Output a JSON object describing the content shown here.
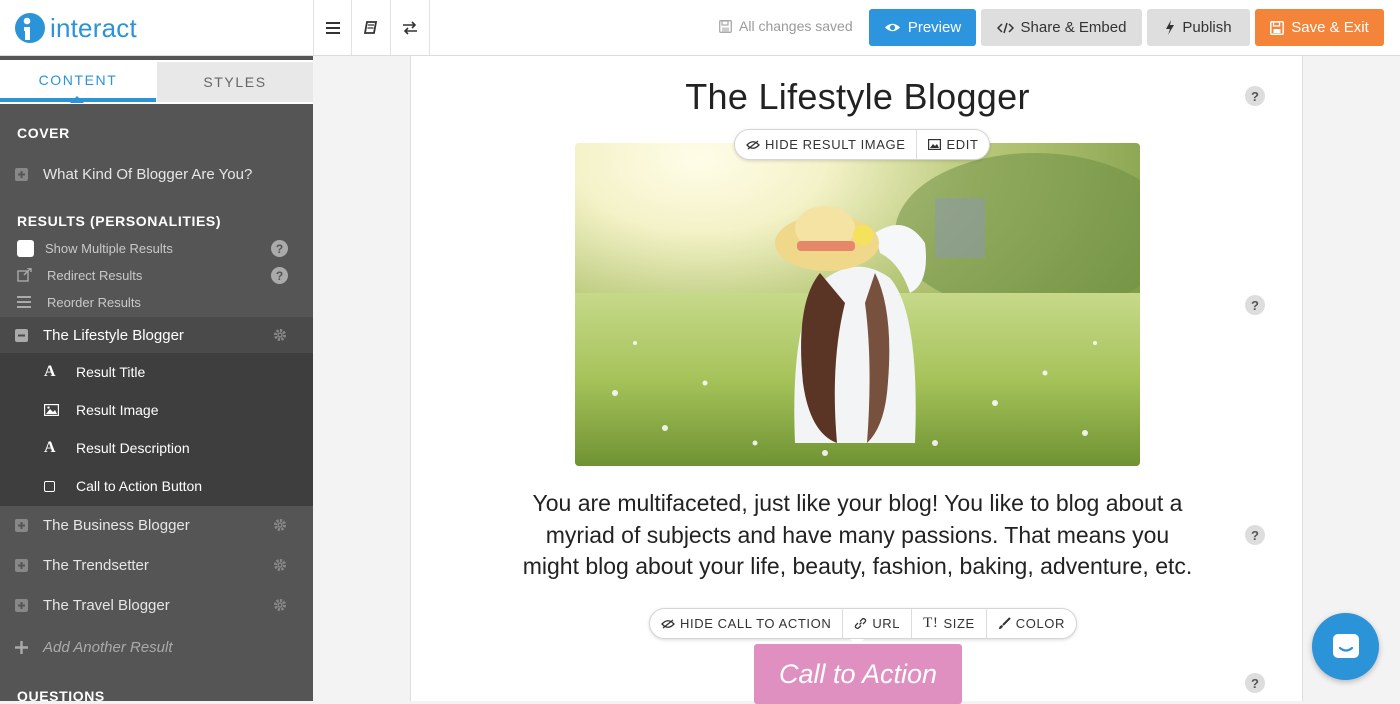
{
  "app": {
    "name": "interact",
    "brand_color": "#2b93d8"
  },
  "toolbar": {
    "saved_status": "All changes saved",
    "preview_label": "Preview",
    "share_label": "Share & Embed",
    "publish_label": "Publish",
    "save_exit_label": "Save & Exit"
  },
  "sidebar": {
    "tabs": [
      {
        "label": "CONTENT",
        "active": true
      },
      {
        "label": "STYLES",
        "active": false
      }
    ],
    "cover_heading": "COVER",
    "cover_item": "What Kind Of Blogger Are You?",
    "results_heading": "RESULTS (PERSONALITIES)",
    "options": [
      {
        "label": "Show Multiple Results",
        "icon": "checkbox-icon"
      },
      {
        "label": "Redirect Results",
        "icon": "external-link-icon"
      },
      {
        "label": "Reorder Results",
        "icon": "reorder-icon"
      }
    ],
    "active_result": "The Lifestyle Blogger",
    "sub_items": [
      {
        "label": "Result Title",
        "icon": "text-icon"
      },
      {
        "label": "Result Image",
        "icon": "image-icon"
      },
      {
        "label": "Result Description",
        "icon": "text-icon"
      },
      {
        "label": "Call to Action Button",
        "icon": "button-icon"
      }
    ],
    "other_results": [
      "The Business Blogger",
      "The Trendsetter",
      "The Travel Blogger"
    ],
    "add_result": "Add Another Result",
    "questions_heading": "QUESTIONS"
  },
  "stage": {
    "result_title": "The Lifestyle Blogger",
    "image_toolbar": {
      "hide": "HIDE RESULT IMAGE",
      "edit": "EDIT"
    },
    "description": "You are multifaceted, just like your blog! You like to blog about a myriad of subjects and have many passions. That means you might blog about your life, beauty, fashion, baking, adventure, etc.",
    "cta_toolbar": {
      "hide": "HIDE CALL TO ACTION",
      "url": "URL",
      "size": "SIZE",
      "color": "COLOR"
    },
    "cta_label": "Call to Action",
    "help_symbol": "?"
  },
  "colors": {
    "preview": "#2c95dd",
    "save_exit": "#f4843a",
    "cta": "#e090c0",
    "sidebar": "#555555",
    "sidebar_active": "#3e3e3e"
  }
}
